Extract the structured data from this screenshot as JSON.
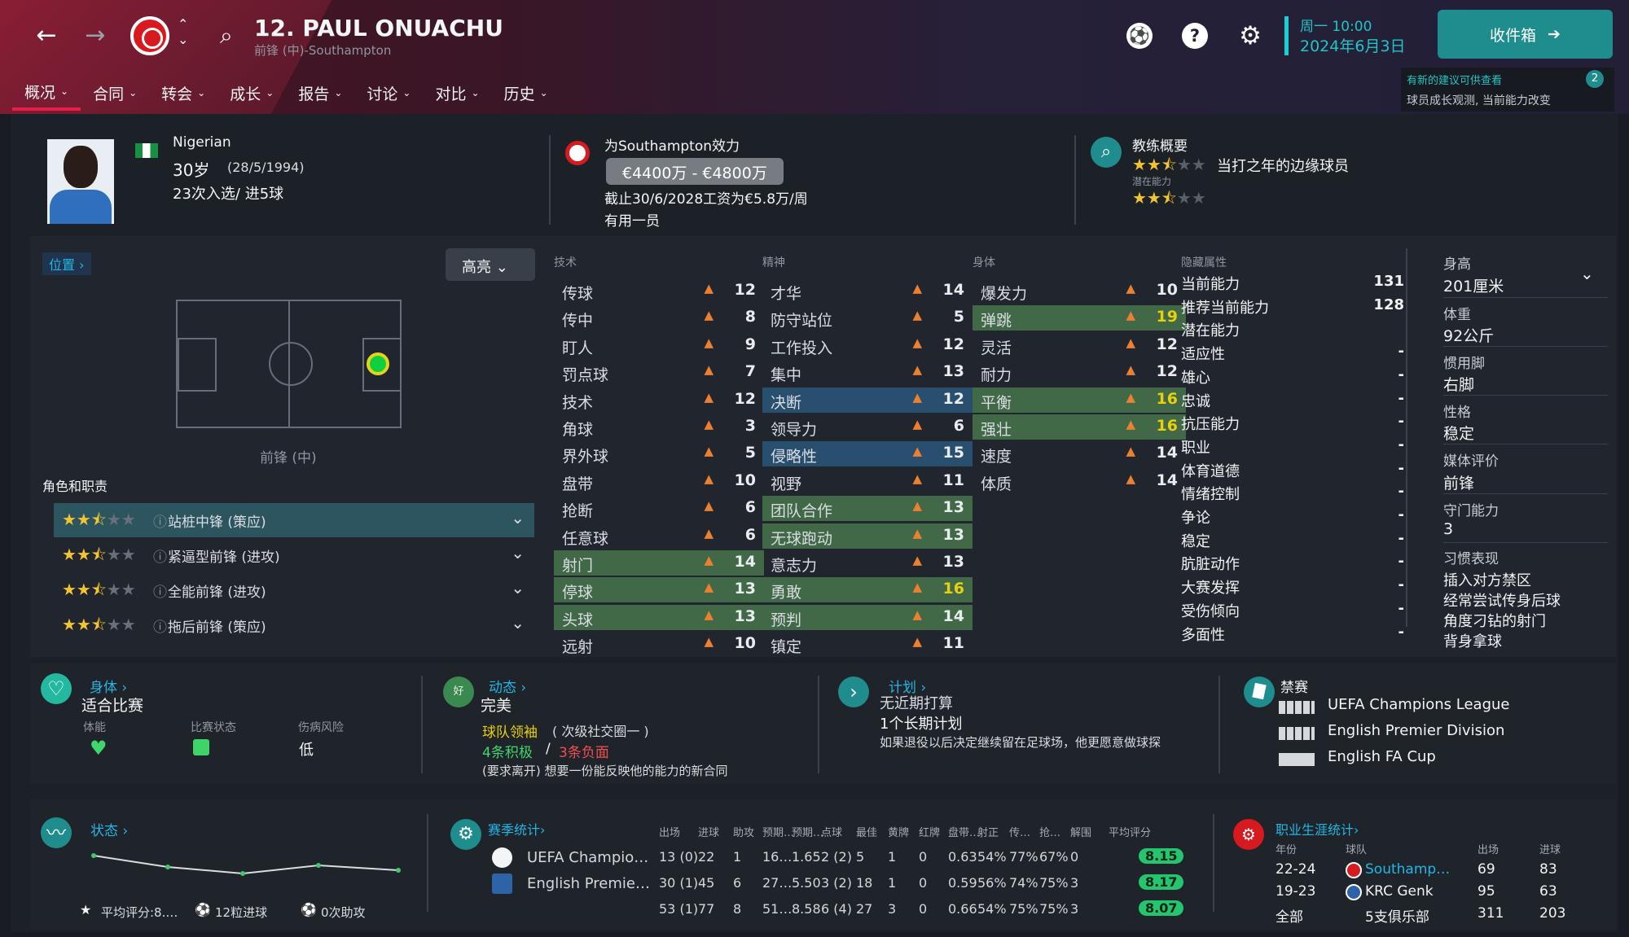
{
  "header": {
    "title": "12. PAUL ONUACHU",
    "subtitle": "前锋 (中)-Southampton",
    "date_time": "周一 10:00",
    "date": "2024年6月3日",
    "inbox": "收件箱",
    "notice_title": "有新的建议可供查看",
    "notice_text": "球员成长观测, 当前能力改变",
    "notice_count": "2"
  },
  "tabs": [
    {
      "label": "概况"
    },
    {
      "label": "合同"
    },
    {
      "label": "转会"
    },
    {
      "label": "成长"
    },
    {
      "label": "报告"
    },
    {
      "label": "讨论"
    },
    {
      "label": "对比"
    },
    {
      "label": "历史"
    }
  ],
  "profile": {
    "nationality": "Nigerian",
    "age": "30岁",
    "birth": "(28/5/1994)",
    "caps": "23次入选/ 进5球",
    "club_line": "为Southampton效力",
    "value": "€4400万 - €4800万",
    "contract": "截止30/6/2028工资为€5.8万/周",
    "status": "有用一员",
    "coach_title": "教练概要",
    "coach_text": "当打之年的边缘球员",
    "potential_label": "潜在能力"
  },
  "position": {
    "link": "位置",
    "highlight": "高亮",
    "name": "前锋 (中)",
    "roles_title": "角色和职责",
    "roles": [
      "站桩中锋 (策应)",
      "紧逼型前锋 (进攻)",
      "全能前锋 (进攻)",
      "拖后前锋 (策应)"
    ]
  },
  "technical": {
    "title": "技术",
    "rows": [
      {
        "name": "传球",
        "val": "12"
      },
      {
        "name": "传中",
        "val": "8"
      },
      {
        "name": "盯人",
        "val": "9"
      },
      {
        "name": "罚点球",
        "val": "7"
      },
      {
        "name": "技术",
        "val": "12"
      },
      {
        "name": "角球",
        "val": "3"
      },
      {
        "name": "界外球",
        "val": "5"
      },
      {
        "name": "盘带",
        "val": "10"
      },
      {
        "name": "抢断",
        "val": "6"
      },
      {
        "name": "任意球",
        "val": "6"
      },
      {
        "name": "射门",
        "val": "14"
      },
      {
        "name": "停球",
        "val": "13"
      },
      {
        "name": "头球",
        "val": "13"
      },
      {
        "name": "远射",
        "val": "10"
      }
    ]
  },
  "mental": {
    "title": "精神",
    "rows": [
      {
        "name": "才华",
        "val": "14"
      },
      {
        "name": "防守站位",
        "val": "5"
      },
      {
        "name": "工作投入",
        "val": "12"
      },
      {
        "name": "集中",
        "val": "13"
      },
      {
        "name": "决断",
        "val": "12"
      },
      {
        "name": "领导力",
        "val": "6"
      },
      {
        "name": "侵略性",
        "val": "15"
      },
      {
        "name": "视野",
        "val": "11"
      },
      {
        "name": "团队合作",
        "val": "13"
      },
      {
        "name": "无球跑动",
        "val": "13"
      },
      {
        "name": "意志力",
        "val": "13"
      },
      {
        "name": "勇敢",
        "val": "16"
      },
      {
        "name": "预判",
        "val": "14"
      },
      {
        "name": "镇定",
        "val": "11"
      }
    ]
  },
  "physical": {
    "title": "身体",
    "rows": [
      {
        "name": "爆发力",
        "val": "10"
      },
      {
        "name": "弹跳",
        "val": "19"
      },
      {
        "name": "灵活",
        "val": "12"
      },
      {
        "name": "耐力",
        "val": "12"
      },
      {
        "name": "平衡",
        "val": "16"
      },
      {
        "name": "强壮",
        "val": "16"
      },
      {
        "name": "速度",
        "val": "14"
      },
      {
        "name": "体质",
        "val": "14"
      }
    ]
  },
  "hidden": {
    "title": "隐藏属性",
    "rows": [
      {
        "name": "当前能力",
        "val": "131"
      },
      {
        "name": "推荐当前能力",
        "val": "128"
      },
      {
        "name": "潜在能力",
        "val": ""
      },
      {
        "name": "适应性",
        "val": "-"
      },
      {
        "name": "雄心",
        "val": "-"
      },
      {
        "name": "忠诚",
        "val": "-"
      },
      {
        "name": "抗压能力",
        "val": "-"
      },
      {
        "name": "职业",
        "val": "-"
      },
      {
        "name": "体育道德",
        "val": "-"
      },
      {
        "name": "情绪控制",
        "val": "-"
      },
      {
        "name": "争论",
        "val": "-"
      },
      {
        "name": "稳定",
        "val": "-"
      },
      {
        "name": "肮脏动作",
        "val": "-"
      },
      {
        "name": "大赛发挥",
        "val": "-"
      },
      {
        "name": "受伤倾向",
        "val": "-"
      },
      {
        "name": "多面性",
        "val": "-"
      }
    ]
  },
  "side": {
    "height_label": "身高",
    "height": "201厘米",
    "weight_label": "体重",
    "weight": "92公斤",
    "foot_label": "惯用脚",
    "foot": "右脚",
    "personality_label": "性格",
    "personality": "稳定",
    "media_label": "媒体评价",
    "media": "前锋",
    "defense_label": "守门能力",
    "defense": "3",
    "habits_label": "习惯表现",
    "habits": [
      "插入对方禁区",
      "经常尝试传身后球",
      "角度刁钻的射门",
      "背身拿球"
    ]
  },
  "cards": {
    "body_title": "身体",
    "body_status": "适合比赛",
    "fitness_label": "体能",
    "form_label": "比赛状态",
    "injury_label": "伤病风险",
    "injury": "低",
    "dynamics_title": "动态",
    "dynamics_status": "完美",
    "dynamics_badge": "好",
    "leader": "球队领袖",
    "leader_note": "( 次级社交圈一 )",
    "positive": "4条积极",
    "negative": "3条负面",
    "demand": "(要求离开) 想要一份能反映他的能力的新合同",
    "plan_title": "计划",
    "plan1": "无近期打算",
    "plan2": "1个长期计划",
    "plan3": "如果退役以后决定继续留在足球场，他更愿意做球探",
    "ban_title": "禁赛",
    "bans": [
      "UEFA Champions League",
      "English Premier Division",
      "English FA Cup"
    ]
  },
  "bottom": {
    "form_title": "状态",
    "form_summary": "平均评分:8.…",
    "goals": "12粒进球",
    "assists": "0次助攻",
    "season_title": "赛季统计",
    "season_headers": [
      "出场",
      "进球",
      "助攻",
      "预期…",
      "预期…",
      "点球",
      "最佳",
      "黄牌",
      "红牌",
      "盘带…",
      "射正",
      "传…",
      "抢…",
      "解围",
      "平均评分"
    ],
    "season_rows": [
      {
        "name": "UEFA Champio…",
        "cells": [
          "13 (0)",
          "22",
          "1",
          "16…",
          "1.65",
          "2 (2)",
          "5",
          "1",
          "0",
          "0.63",
          "54%",
          "77%",
          "67%",
          "0"
        ],
        "rating": "8.15"
      },
      {
        "name": "English Premie…",
        "cells": [
          "30 (1)",
          "45",
          "6",
          "27…",
          "5.50",
          "3 (2)",
          "18",
          "1",
          "0",
          "0.59",
          "56%",
          "74%",
          "75%",
          "3"
        ],
        "rating": "8.17"
      },
      {
        "name": "",
        "cells": [
          "53 (1)",
          "77",
          "8",
          "51…",
          "8.58",
          "6 (4)",
          "27",
          "3",
          "0",
          "0.66",
          "54%",
          "75%",
          "75%",
          "3"
        ],
        "rating": "8.07"
      }
    ],
    "career_title": "职业生涯统计",
    "career_headers": [
      "年份",
      "球队",
      "出场",
      "进球"
    ],
    "career_rows": [
      {
        "year": "22-24",
        "club": "Southamp…",
        "apps": "69",
        "goals": "83"
      },
      {
        "year": "19-23",
        "club": "KRC Genk",
        "apps": "95",
        "goals": "63"
      },
      {
        "year": "全部",
        "club": "5支俱乐部",
        "apps": "311",
        "goals": "203"
      }
    ]
  },
  "colors": {
    "accent": "#e91e47",
    "teal": "#1f8d8d",
    "blue_highlight": "#294f6f",
    "green_highlight": "#416947",
    "arrow": "#ec8031",
    "yellow": "#e8d00d"
  }
}
